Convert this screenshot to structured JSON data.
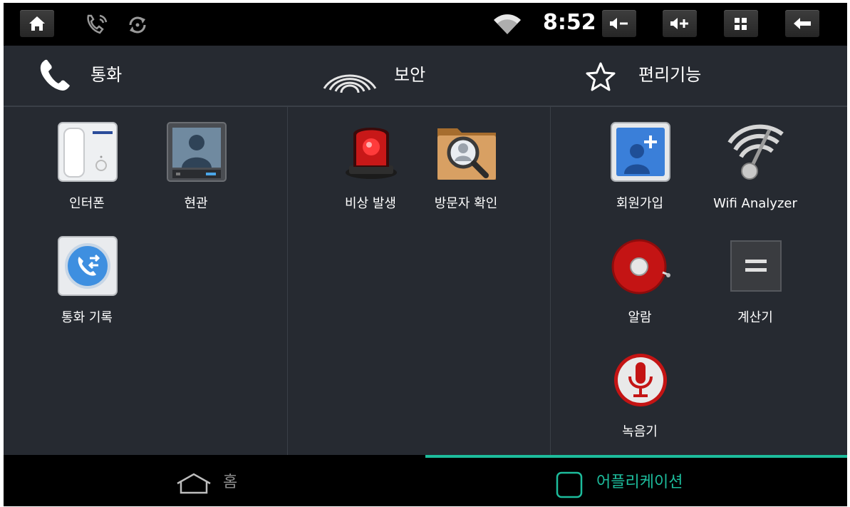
{
  "status_bar": {
    "clock": "8:52",
    "icons": [
      "home-icon",
      "call-forward-icon",
      "sync-icon",
      "wifi-icon"
    ],
    "buttons": [
      "volume-down",
      "volume-up",
      "apps",
      "back"
    ]
  },
  "categories": [
    {
      "label": "통화",
      "icon": "phone-icon"
    },
    {
      "label": "보안",
      "icon": "signal-waves-icon"
    },
    {
      "label": "편리기능",
      "icon": "star-icon"
    }
  ],
  "panels": {
    "call": [
      {
        "label": "인터폰",
        "icon": "intercom-icon"
      },
      {
        "label": "현관",
        "icon": "door-camera-icon"
      },
      {
        "label": "통화 기록",
        "icon": "call-log-icon"
      }
    ],
    "security": [
      {
        "label": "비상 발생",
        "icon": "emergency-siren-icon"
      },
      {
        "label": "방문자 확인",
        "icon": "visitor-search-icon"
      }
    ],
    "convenience": [
      {
        "label": "회원가입",
        "icon": "add-contact-icon"
      },
      {
        "label": "Wifi Analyzer",
        "icon": "wifi-analyzer-icon"
      },
      {
        "label": "알람",
        "icon": "alarm-bell-icon"
      },
      {
        "label": "계산기",
        "icon": "calculator-icon"
      },
      {
        "label": "녹음기",
        "icon": "microphone-icon"
      }
    ]
  },
  "bottom_bar": {
    "tabs": [
      {
        "label": "홈",
        "icon": "home-outline-icon",
        "active": false
      },
      {
        "label": "어플리케이션",
        "icon": "square-outline-icon",
        "active": true
      }
    ]
  },
  "colors": {
    "background": "#262a31",
    "accent": "#1dbc9c",
    "bar": "#000000"
  }
}
